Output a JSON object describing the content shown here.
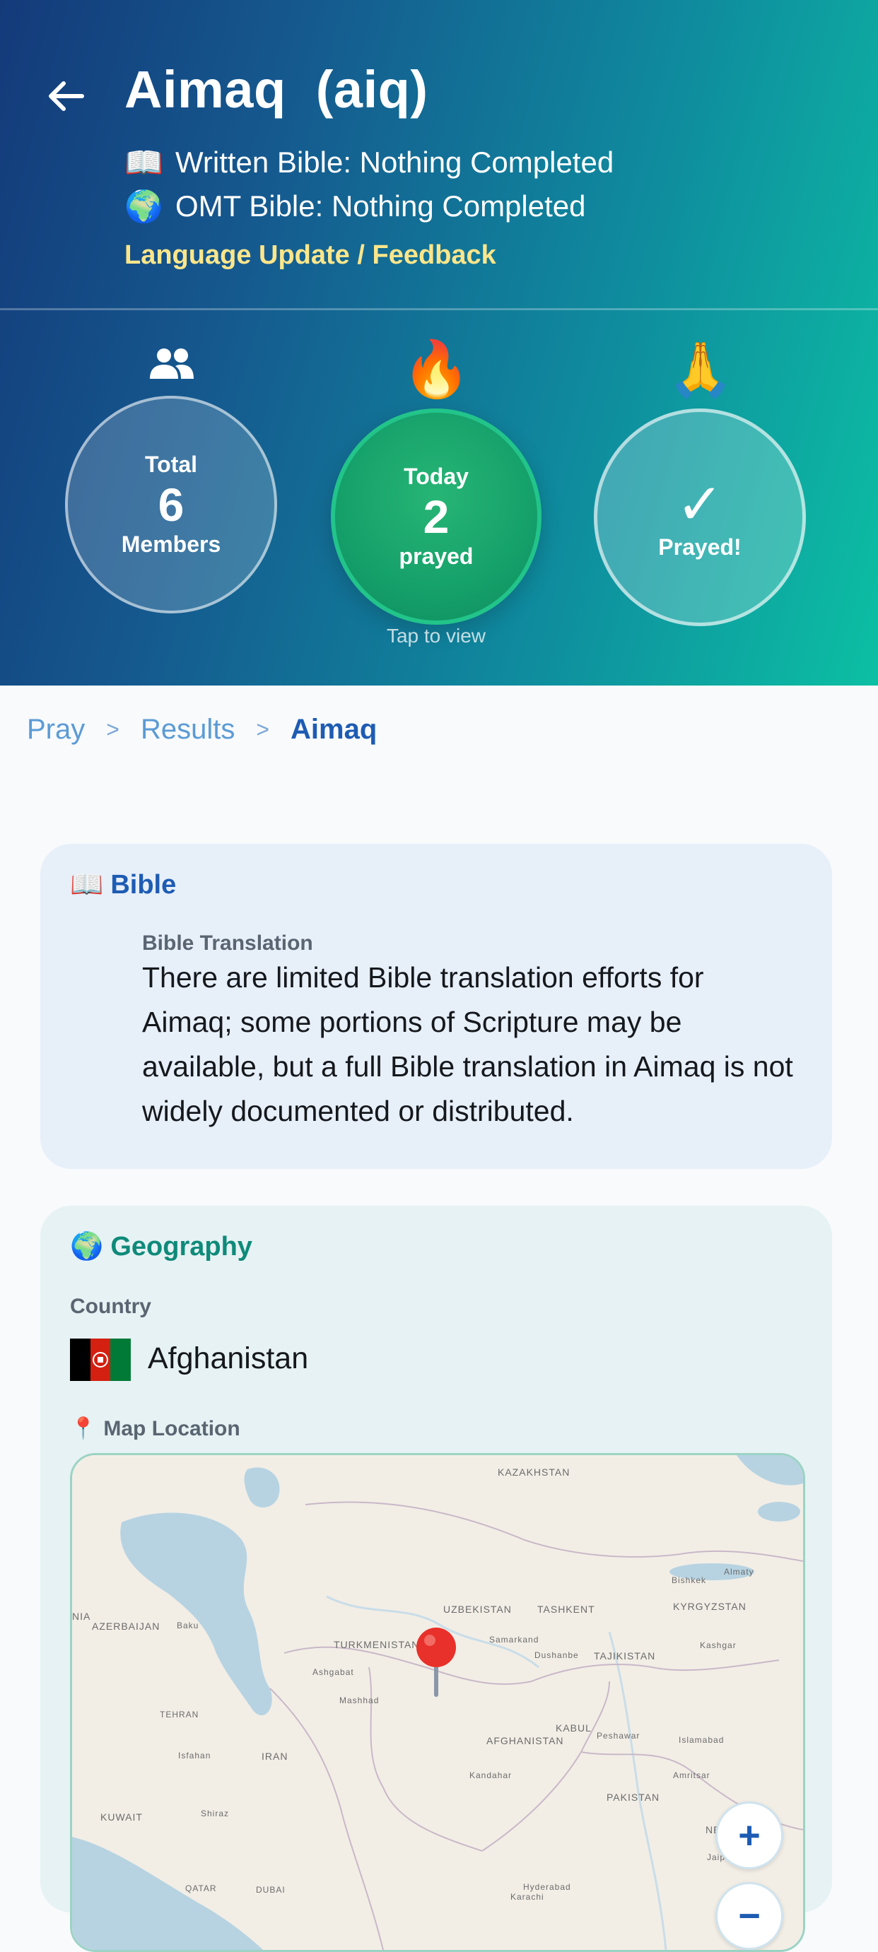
{
  "header": {
    "title": "Aimaq  (aiq)",
    "written_icon": "📖",
    "written_status": "Written Bible: Nothing Completed",
    "omt_icon": "🌍",
    "omt_status": "OMT Bible: Nothing Completed",
    "feedback_link": "Language Update / Feedback"
  },
  "stats": {
    "total": {
      "icon": "people-icon",
      "label_top": "Total",
      "value": "6",
      "label_bottom": "Members"
    },
    "today": {
      "icon": "🔥",
      "label_top": "Today",
      "value": "2",
      "label_bottom": "prayed",
      "hint": "Tap to view"
    },
    "prayed": {
      "icon": "🙏",
      "check": "✓",
      "label": "Prayed!"
    }
  },
  "breadcrumb": {
    "items": [
      "Pray",
      "Results"
    ],
    "separator": ">",
    "current": "Aimaq"
  },
  "bible_card": {
    "icon": "📖",
    "title": "Bible",
    "field_label": "Bible Translation",
    "text": "There are limited Bible translation efforts for Aimaq; some portions of Scripture may be available, but a full Bible translation in Aimaq is not widely documented or distributed."
  },
  "geo_card": {
    "icon": "🌍",
    "title": "Geography",
    "country_label": "Country",
    "country": "Afghanistan",
    "map_icon": "📍",
    "map_label": "Map Location",
    "zoom_in": "+",
    "zoom_out": "−",
    "map_labels": [
      "KAZAKHSTAN",
      "UZBEKISTAN",
      "TASHKENT",
      "KYRGYZSTAN",
      "Bishkek",
      "Almaty",
      "AZERBAIJAN",
      "Baku",
      "TURKMENISTAN",
      "Samarkand",
      "Dushanbe",
      "TAJIKISTAN",
      "Kashgar",
      "Ashgabat",
      "Mashhad",
      "TEHRAN",
      "KABUL",
      "Peshawar",
      "AFGHANISTAN",
      "Islamabad",
      "Isfahan",
      "IRAN",
      "Kandahar",
      "Amritsar",
      "PAKISTAN",
      "KUWAIT",
      "Shiraz",
      "QATAR",
      "DUBAI",
      "Hyderabad",
      "Karachi",
      "NEW",
      "Jaip",
      "NIA"
    ]
  },
  "colors": {
    "accent": "#1e5cb3",
    "geo_accent": "#0f8a7a",
    "feedback": "#fde68a",
    "today_green": "#15a06a"
  }
}
